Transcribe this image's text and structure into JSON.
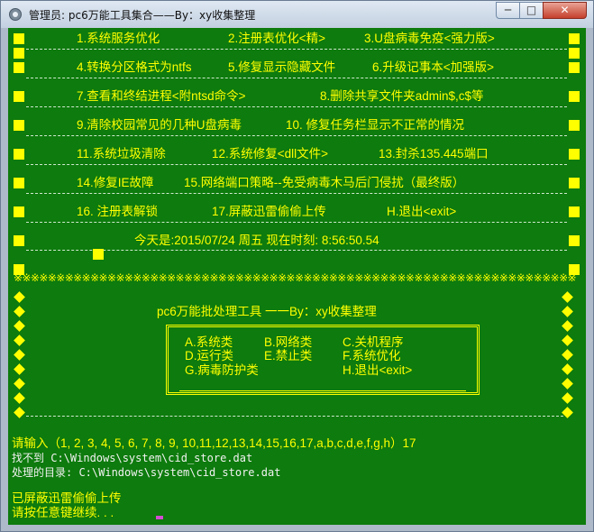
{
  "window": {
    "title": "管理员: pc6万能工具集合——By：xy收集整理",
    "controls": {
      "minimize": "─",
      "maximize": "□",
      "close": "✕"
    },
    "icon": "cmd-app-icon"
  },
  "colors": {
    "background": "#0d7b0d",
    "accent": "#ffff00",
    "text": "#f2f2f2"
  },
  "menu_rows": [
    [
      "1.系统服务优化",
      "2.注册表优化<精>",
      "3.U盘病毒免疫<强力版>"
    ],
    [
      "4.转换分区格式为ntfs",
      "5.修复显示隐藏文件",
      "6.升级记事本<加强版>"
    ],
    [
      "7.查看和终结进程<附ntsd命令>",
      "8.删除共享文件夹admin$,c$等"
    ],
    [
      "9.清除校园常见的几种U盘病毒",
      "10. 修复任务栏显示不正常的情况"
    ],
    [
      "11.系统垃圾清除",
      "12.系统修复<dll文件>",
      "13.封杀135.445端口"
    ],
    [
      "14.修复IE故障",
      "15.网络端口策略--免受病毒木马后门侵扰（最终版）"
    ],
    [
      "16. 注册表解锁",
      "17.屏蔽迅雷偷偷上传",
      "H.退出<exit>"
    ]
  ],
  "date_line": "今天是:2015/07/24 周五 现在时刻: 8:56:50.54",
  "stars": "※※※※※※※※※※※※※※※※※※※※※※※※※※※※※※※※※※※※※※※※※※※※※※※※※※※※※※※※※※※※※※※※※※※※※※※※※※※※※",
  "panel": {
    "title": "pc6万能批处理工具 一一By：xy收集整理",
    "items": [
      [
        "A.系统类",
        "B.网络类",
        "C.关机程序"
      ],
      [
        "D.运行类",
        "E.禁止类",
        "F.系统优化"
      ],
      [
        "G.病毒防护类",
        "H.退出<exit>"
      ]
    ]
  },
  "output": {
    "prompt": "请输入（1, 2, 3, 4, 5, 6, 7, 8, 9, 10,11,12,13,14,15,16,17,a,b,c,d,e,f,g,h）17",
    "not_found": "找不到 C:\\Windows\\system\\cid_store.dat",
    "processed": "处理的目录: C:\\Windows\\system\\cid_store.dat",
    "blocked": "已屏蔽迅雷偷偷上传",
    "press_key": "请按任意键继续. . ."
  }
}
